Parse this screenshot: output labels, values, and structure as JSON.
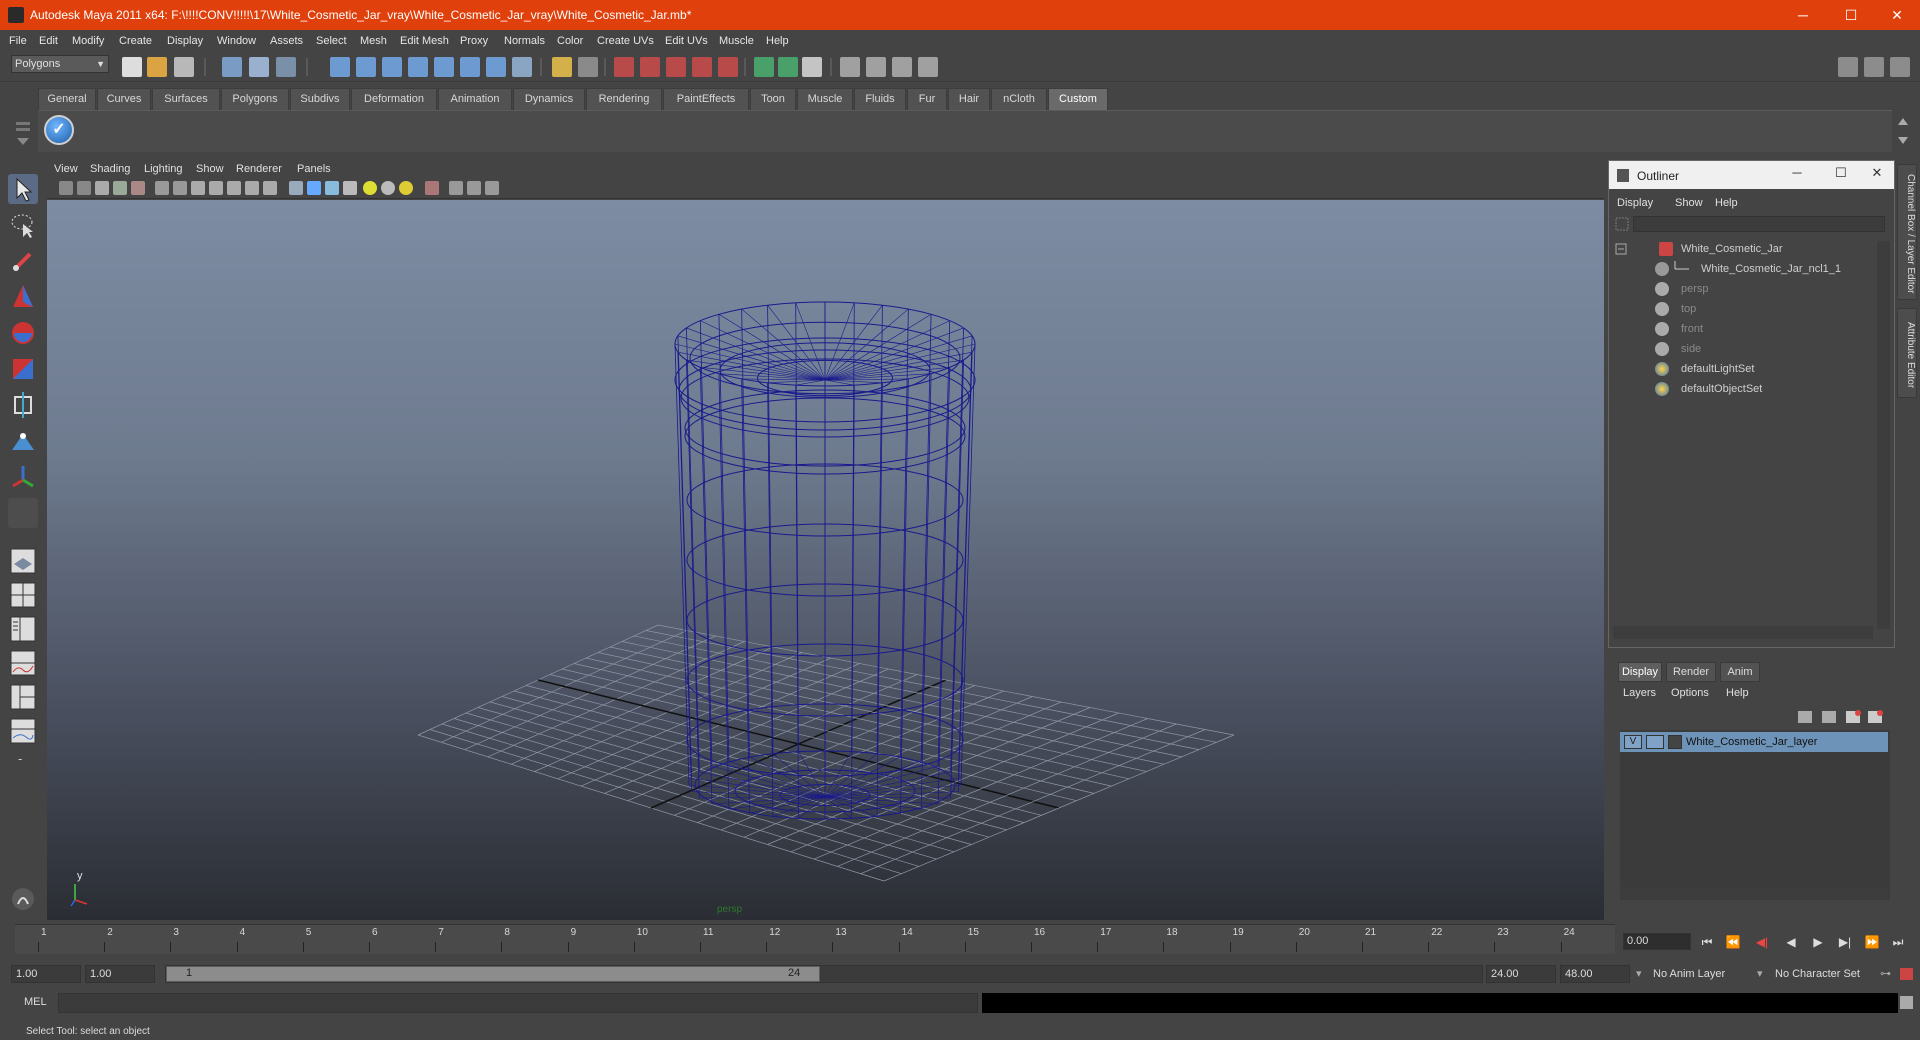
{
  "window": {
    "title": "Autodesk Maya 2011 x64: F:\\!!!!CONV!!!!!\\17\\White_Cosmetic_Jar_vray\\White_Cosmetic_Jar_vray\\White_Cosmetic_Jar.mb*",
    "minimize": "─",
    "maximize": "☐",
    "close": "✕"
  },
  "menubar": [
    "File",
    "Edit",
    "Modify",
    "Create",
    "Display",
    "Window",
    "Assets",
    "Select",
    "Mesh",
    "Edit Mesh",
    "Proxy",
    "Normals",
    "Color",
    "Create UVs",
    "Edit UVs",
    "Muscle",
    "Help"
  ],
  "statusline": {
    "mode": "Polygons"
  },
  "shelf": {
    "tabs": [
      "General",
      "Curves",
      "Surfaces",
      "Polygons",
      "Subdivs",
      "Deformation",
      "Animation",
      "Dynamics",
      "Rendering",
      "PaintEffects",
      "Toon",
      "Muscle",
      "Fluids",
      "Fur",
      "Hair",
      "nCloth",
      "Custom"
    ],
    "active_tab": "Custom",
    "icon": "checkmark-icon"
  },
  "viewport": {
    "menu": [
      "View",
      "Shading",
      "Lighting",
      "Show",
      "Renderer",
      "Panels"
    ],
    "camera_label": "persp",
    "axis_y": "y",
    "axis_x": "x",
    "wire_color": "#1a1a8c"
  },
  "outliner": {
    "title": "Outliner",
    "menu": [
      "Display",
      "Show",
      "Help"
    ],
    "items": [
      {
        "label": "White_Cosmetic_Jar",
        "icon": "transform-icon",
        "dim": false
      },
      {
        "label": "White_Cosmetic_Jar_ncl1_1",
        "icon": "mesh-icon",
        "dim": false
      },
      {
        "label": "persp",
        "icon": "camera-icon",
        "dim": true
      },
      {
        "label": "top",
        "icon": "camera-icon",
        "dim": true
      },
      {
        "label": "front",
        "icon": "camera-icon",
        "dim": true
      },
      {
        "label": "side",
        "icon": "camera-icon",
        "dim": true
      },
      {
        "label": "defaultLightSet",
        "icon": "set-icon",
        "dim": false
      },
      {
        "label": "defaultObjectSet",
        "icon": "set-icon",
        "dim": false
      }
    ]
  },
  "layer_editor": {
    "tabs": [
      "Display",
      "Render",
      "Anim"
    ],
    "active_tab": "Display",
    "menu": [
      "Layers",
      "Options",
      "Help"
    ],
    "layer": {
      "visible": "V",
      "name": "White_Cosmetic_Jar_layer"
    }
  },
  "side_tabs": [
    "Channel Box / Layer Editor",
    "Attribute Editor"
  ],
  "timeline": {
    "frames": [
      "1",
      "2",
      "3",
      "4",
      "5",
      "6",
      "7",
      "8",
      "9",
      "10",
      "11",
      "12",
      "13",
      "14",
      "15",
      "16",
      "17",
      "18",
      "19",
      "20",
      "21",
      "22",
      "23",
      "24"
    ],
    "current_frame": "0.00"
  },
  "range": {
    "start": "1.00",
    "current": "1.00",
    "slider_start": "1",
    "slider_end": "24",
    "end": "24.00",
    "max": "48.00",
    "anim_layer": "No Anim Layer",
    "character_set": "No Character Set"
  },
  "cmdline": {
    "label": "MEL"
  },
  "helpline": {
    "text": "Select Tool: select an object"
  }
}
